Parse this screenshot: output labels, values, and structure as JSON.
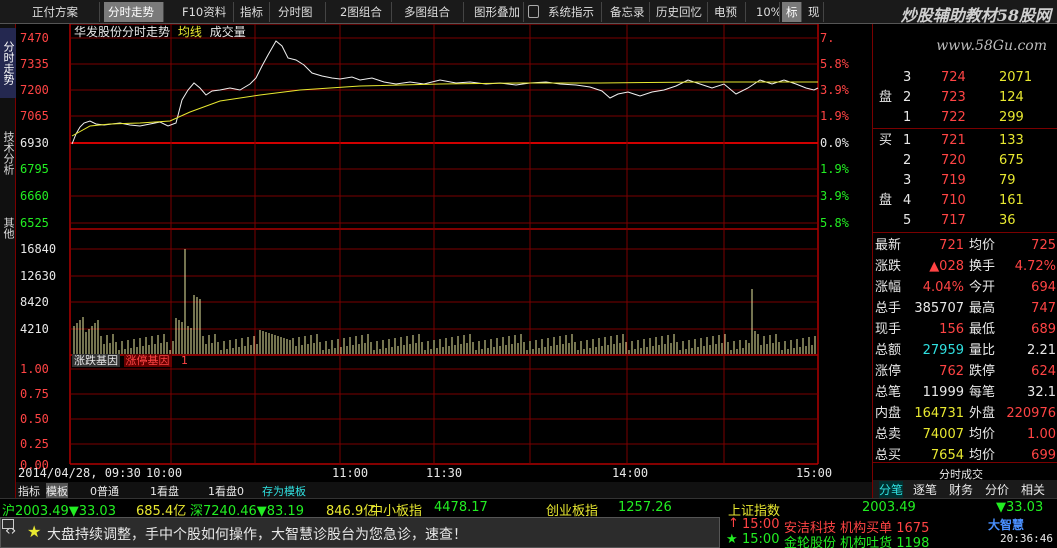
{
  "toolbar": {
    "items": [
      "正付方案",
      "分时走势",
      "F10资料",
      "指标",
      "分时图",
      "2图组合",
      "多图组合",
      "图形叠加",
      "系统指示",
      "备忘录",
      "历史回忆",
      "电预",
      "10%",
      "标",
      "现"
    ],
    "active_index": 1,
    "watermark": "炒股辅助教材58股网",
    "watermark_url": "www.58Gu.com"
  },
  "left_tabs": [
    "分时走势",
    "技术分析",
    "其他"
  ],
  "chart_header": {
    "stock": "华发股份分时走势",
    "avg_label": "均线",
    "vol_label": "成交量"
  },
  "price_axis_left": [
    "7470",
    "7335",
    "7200",
    "7065",
    "6930",
    "6795",
    "6660",
    "6525"
  ],
  "price_axis_right": [
    "7.",
    "5.8%",
    "3.9%",
    "1.9%",
    "0.0%",
    "1.9%",
    "3.9%",
    "5.8%"
  ],
  "volume_axis": [
    "16840",
    "12630",
    "8420",
    "4210"
  ],
  "indicator": {
    "tab1": "涨跌基因",
    "tab2": "涨停基因",
    "value": "1",
    "axis": [
      "1.00",
      "0.75",
      "0.50",
      "0.25",
      "0.00"
    ]
  },
  "time_axis": {
    "date": "2014/04/28, 09:30",
    "labels": [
      "10:00",
      "11:00",
      "11:30",
      "14:00",
      "15:00"
    ]
  },
  "order_book": {
    "sell": [
      {
        "side": "",
        "n": "3",
        "price": "724",
        "vol": "2071"
      },
      {
        "side": "盘",
        "n": "2",
        "price": "723",
        "vol": "124"
      },
      {
        "side": "",
        "n": "1",
        "price": "722",
        "vol": "299"
      }
    ],
    "buy": [
      {
        "side": "买",
        "n": "1",
        "price": "721",
        "vol": "133"
      },
      {
        "side": "",
        "n": "2",
        "price": "720",
        "vol": "675"
      },
      {
        "side": "",
        "n": "3",
        "price": "719",
        "vol": "79"
      },
      {
        "side": "盘",
        "n": "4",
        "price": "710",
        "vol": "161"
      },
      {
        "side": "",
        "n": "5",
        "price": "717",
        "vol": "36"
      }
    ]
  },
  "quote": [
    {
      "l": "最新",
      "v": "721",
      "l2": "均价",
      "v2": "725"
    },
    {
      "l": "涨跌",
      "v": "▲028",
      "l2": "换手",
      "v2": "4.72%"
    },
    {
      "l": "涨幅",
      "v": "4.04%",
      "l2": "今开",
      "v2": "694"
    },
    {
      "l": "总手",
      "v": "385707",
      "l2": "最高",
      "v2": "747"
    },
    {
      "l": "现手",
      "v": "156",
      "l2": "最低",
      "v2": "689"
    },
    {
      "l": "总额",
      "v": "27959",
      "l2": "量比",
      "v2": "2.21"
    },
    {
      "l": "涨停",
      "v": "762",
      "l2": "跌停",
      "v2": "624"
    },
    {
      "l": "总笔",
      "v": "11999",
      "l2": "每笔",
      "v2": "32.1"
    },
    {
      "l": "内盘",
      "v": "164731",
      "l2": "外盘",
      "v2": "220976"
    },
    {
      "l": "总卖",
      "v": "74007",
      "l2": "均价",
      "v2": "1.00"
    },
    {
      "l": "总买",
      "v": "7654",
      "l2": "均价",
      "v2": "699"
    }
  ],
  "right_tabs": [
    "分笔",
    "逐笔",
    "财务",
    "分价",
    "相关"
  ],
  "right_sub": "分时成交",
  "bottom_tabs": [
    "指标",
    "模板",
    "0普通",
    "1看盘",
    "1看盘0",
    "存为模板"
  ],
  "index_bar": {
    "sh": "沪2003.49▼33.03",
    "sh_amt": "685.4亿",
    "sz": "深7240.46▼83.19",
    "sz_amt": "846.9亿",
    "zxb_label": "中小板指",
    "zxb": "4478.17",
    "cyb_label": "创业板指",
    "cyb": "1257.26",
    "szzs_label": "上证指数",
    "szzs": "2003.49",
    "szzs_chg": "▼33.03"
  },
  "message": "大盘持续调整，手中个股如何操作，大智慧诊股台为您急诊，速查！",
  "news": [
    {
      "time": "15:00",
      "text": "安洁科技 机构买单 1675"
    },
    {
      "time": "15:00",
      "text": "金轮股份 机构吐货 1198"
    }
  ],
  "clock": "20:36:46",
  "brand": "大智慧"
}
